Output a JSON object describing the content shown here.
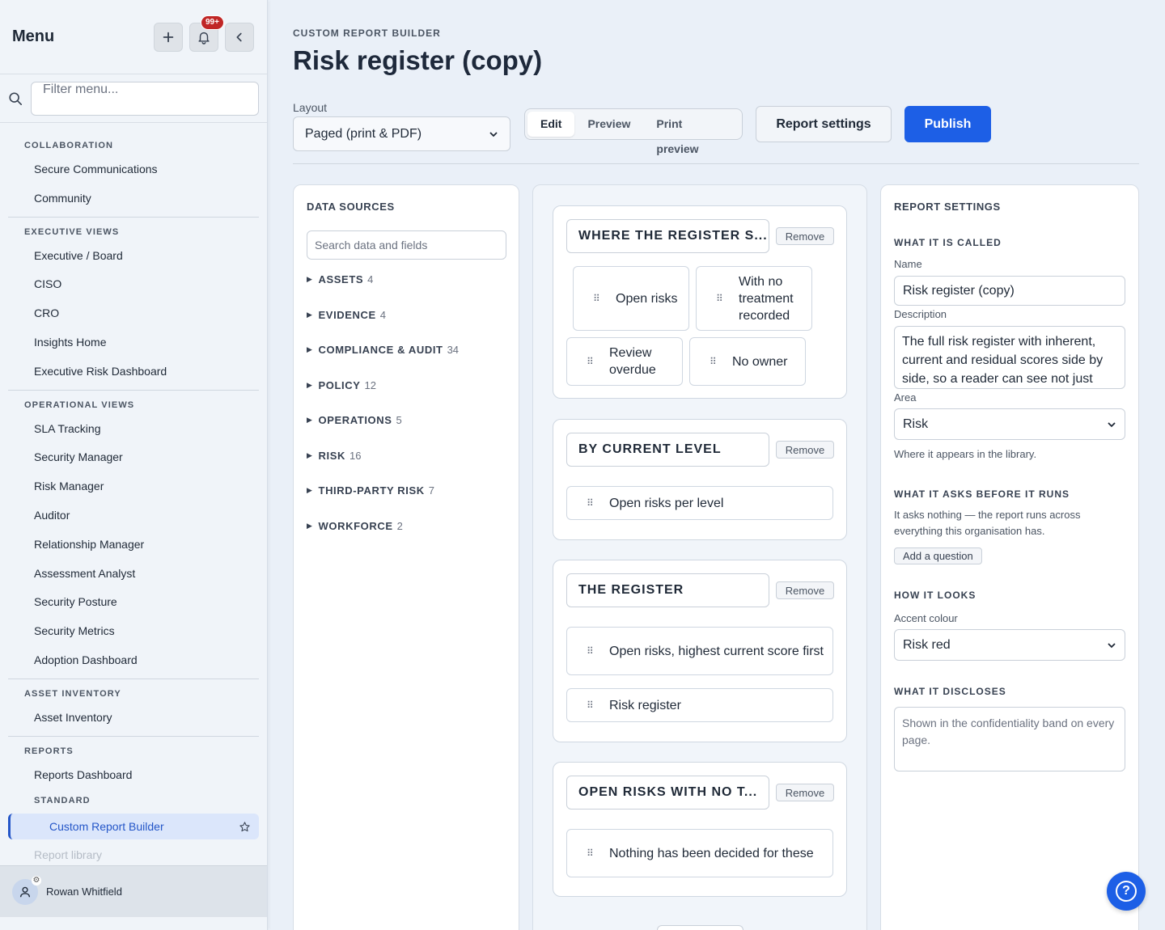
{
  "sidebar": {
    "title": "Menu",
    "notification_count": "99+",
    "filter_placeholder": "Filter menu...",
    "groups": [
      {
        "label": "COLLABORATION",
        "items": [
          "Secure Communications",
          "Community"
        ]
      },
      {
        "label": "EXECUTIVE VIEWS",
        "items": [
          "Executive / Board",
          "CISO",
          "CRO",
          "Insights Home",
          "Executive Risk Dashboard"
        ]
      },
      {
        "label": "OPERATIONAL VIEWS",
        "items": [
          "SLA Tracking",
          "Security Manager",
          "Risk Manager",
          "Auditor",
          "Relationship Manager",
          "Assessment Analyst",
          "Security Posture",
          "Security Metrics",
          "Adoption Dashboard"
        ]
      },
      {
        "label": "ASSET INVENTORY",
        "items": [
          "Asset Inventory"
        ]
      },
      {
        "label": "REPORTS",
        "items": [
          "Reports Dashboard"
        ],
        "sub_label": "STANDARD",
        "active_item": "Custom Report Builder",
        "faded_item": "Report library"
      }
    ],
    "user_name": "Rowan Whitfield"
  },
  "header": {
    "eyebrow": "CUSTOM REPORT BUILDER",
    "title": "Risk register (copy)",
    "layout_label": "Layout",
    "layout_value": "Paged (print & PDF)",
    "modes": [
      "Edit",
      "Preview",
      "Print preview"
    ],
    "active_mode": "Edit",
    "settings_button": "Report settings",
    "publish_button": "Publish"
  },
  "data_sources": {
    "title": "DATA SOURCES",
    "search_placeholder": "Search data and fields",
    "items": [
      {
        "label": "ASSETS",
        "count": "4"
      },
      {
        "label": "EVIDENCE",
        "count": "4"
      },
      {
        "label": "COMPLIANCE & AUDIT",
        "count": "34"
      },
      {
        "label": "POLICY",
        "count": "12"
      },
      {
        "label": "OPERATIONS",
        "count": "5"
      },
      {
        "label": "RISK",
        "count": "16"
      },
      {
        "label": "THIRD-PARTY RISK",
        "count": "7"
      },
      {
        "label": "WORKFORCE",
        "count": "2"
      }
    ]
  },
  "canvas": {
    "remove_label": "Remove",
    "sections": [
      {
        "title": "WHERE THE REGISTER S...",
        "blocks": [
          "Open risks",
          "With no treatment recorded",
          "Review overdue",
          "No owner"
        ]
      },
      {
        "title": "BY CURRENT LEVEL",
        "blocks": [
          "Open risks per level"
        ]
      },
      {
        "title": "THE REGISTER",
        "blocks": [
          "Open risks, highest current score first",
          "Risk register"
        ]
      },
      {
        "title": "OPEN RISKS WITH NO T...",
        "blocks": [
          "Nothing has been decided for these"
        ]
      }
    ]
  },
  "settings": {
    "title": "REPORT SETTINGS",
    "called_heading": "WHAT IT IS CALLED",
    "name_label": "Name",
    "name_value": "Risk register (copy)",
    "description_label": "Description",
    "description_value": "The full risk register with inherent, current and residual scores side by side, so a reader can see not just",
    "area_label": "Area",
    "area_value": "Risk",
    "area_help": "Where it appears in the library.",
    "asks_heading": "WHAT IT ASKS BEFORE IT RUNS",
    "asks_help": "It asks nothing — the report runs across everything this organisation has.",
    "add_question": "Add a question",
    "looks_heading": "HOW IT LOOKS",
    "accent_label": "Accent colour",
    "accent_value": "Risk red",
    "discloses_heading": "WHAT IT DISCLOSES",
    "discloses_placeholder": "Shown in the confidentiality band on every page."
  },
  "colors": {
    "accent": "#1d5fe6",
    "badge": "#c02626",
    "active_nav": "#2456c8"
  },
  "icons": [
    "plus-icon",
    "bell-icon",
    "chevron-left-icon",
    "search-icon",
    "star-icon",
    "user-icon",
    "help-icon",
    "grip-icon",
    "chevron-down-icon"
  ]
}
